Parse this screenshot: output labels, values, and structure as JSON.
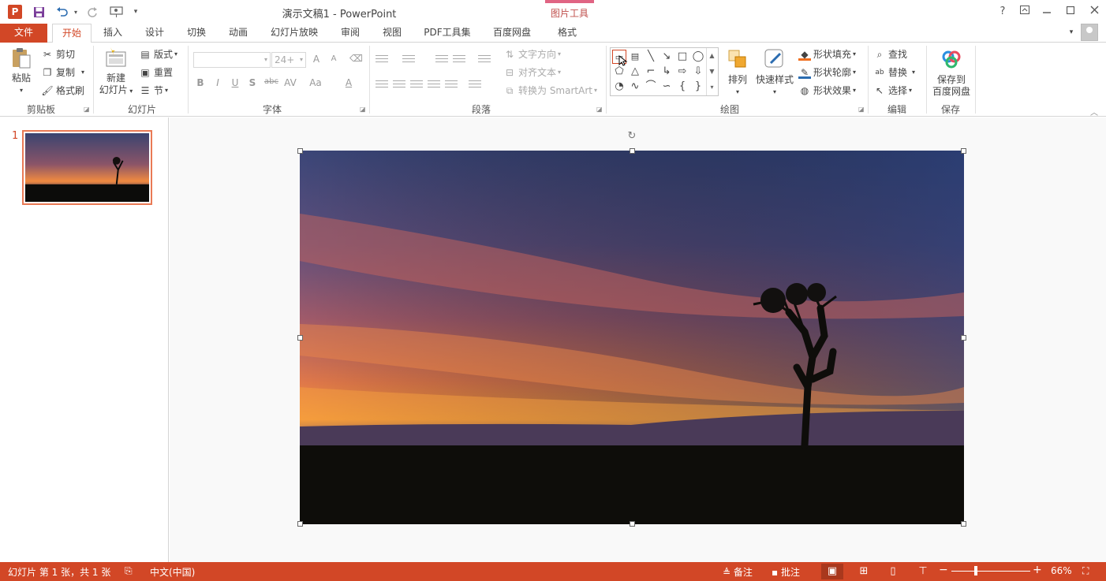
{
  "app": {
    "logo_letter": "P",
    "document_title": "演示文稿1 - PowerPoint",
    "context_tab_group": "图片工具",
    "help_glyph": "?"
  },
  "quick_access": {
    "save_icon": "save-icon",
    "undo_icon": "undo-icon",
    "redo_icon": "redo-icon",
    "present_icon": "start-from-beginning-icon",
    "customize_icon": "customize-qat-icon"
  },
  "tabs": [
    {
      "label": "文件"
    },
    {
      "label": "开始"
    },
    {
      "label": "插入"
    },
    {
      "label": "设计"
    },
    {
      "label": "切换"
    },
    {
      "label": "动画"
    },
    {
      "label": "幻灯片放映"
    },
    {
      "label": "审阅"
    },
    {
      "label": "视图"
    },
    {
      "label": "PDF工具集"
    },
    {
      "label": "百度网盘"
    },
    {
      "label": "格式"
    }
  ],
  "ribbon": {
    "clipboard": {
      "paste": "粘贴",
      "cut": "剪切",
      "copy": "复制",
      "format_painter": "格式刷",
      "group_label": "剪贴板"
    },
    "slides": {
      "new_slide_line1": "新建",
      "new_slide_line2": "幻灯片",
      "layout": "版式",
      "reset": "重置",
      "section": "节",
      "group_label": "幻灯片"
    },
    "font": {
      "font_name": "",
      "font_size": "24+",
      "bold": "B",
      "italic": "I",
      "underline": "U",
      "shadow": "S",
      "strike": "abc",
      "spacing": "AV",
      "case": "Aa",
      "grow": "A",
      "shrink": "A",
      "color": "A",
      "group_label": "字体"
    },
    "paragraph": {
      "text_direction": "文字方向",
      "align_text": "对齐文本",
      "convert_smartart": "转换为 SmartArt",
      "group_label": "段落"
    },
    "drawing": {
      "arrange": "排列",
      "quick_styles": "快速样式",
      "shape_fill": "形状填充",
      "shape_outline": "形状轮廓",
      "shape_effects": "形状效果",
      "group_label": "绘图",
      "shapes": [
        "▭",
        "▤",
        "╲",
        "↘",
        "□",
        "◯",
        "⬠",
        "△",
        "⌐",
        "↳",
        "⇨",
        "⇩",
        "◔",
        "∿",
        "⌒",
        "∽",
        "{",
        "}"
      ]
    },
    "editing": {
      "find": "查找",
      "replace": "替换",
      "select": "选择",
      "group_label": "编辑"
    },
    "save": {
      "save_to_line1": "保存到",
      "save_to_line2": "百度网盘",
      "group_label": "保存"
    }
  },
  "slides_pane": {
    "slide_number": "1"
  },
  "status": {
    "slide_info": "幻灯片 第 1 张，共 1 张",
    "language": "中文(中国)",
    "notes": "备注",
    "comments": "批注",
    "zoom_percent": "66%",
    "zoom_level": 0.66
  },
  "colors": {
    "accent": "#d24726",
    "context_tab": "#e06483"
  }
}
